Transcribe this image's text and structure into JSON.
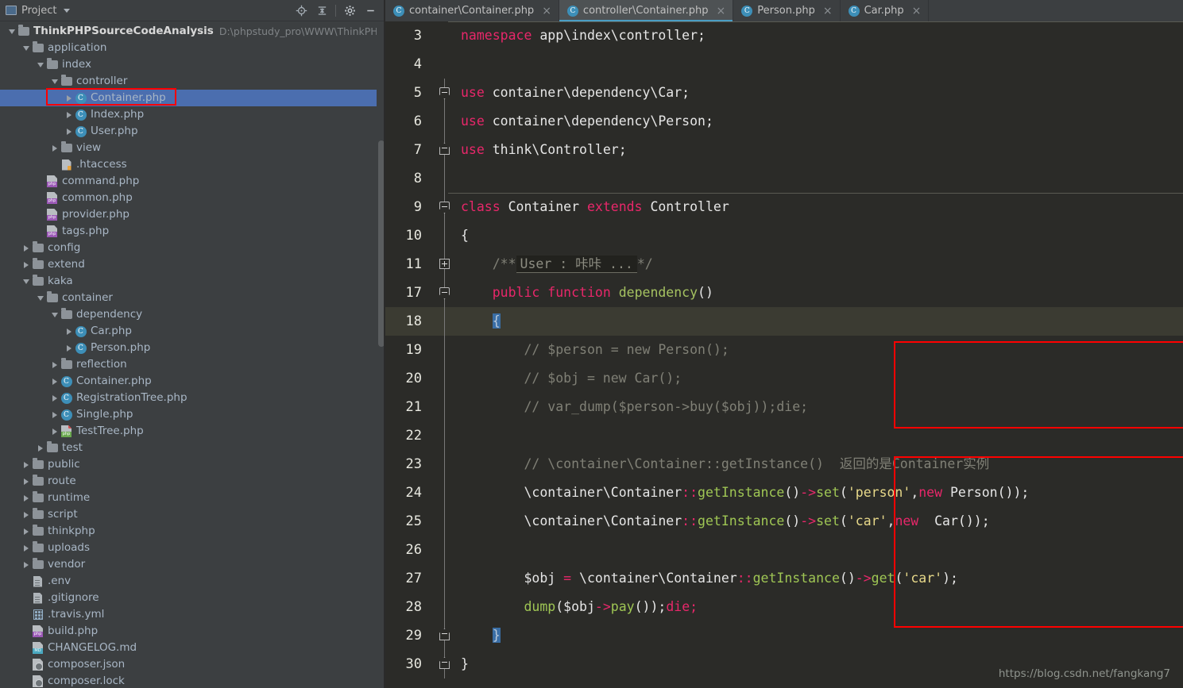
{
  "sidebar": {
    "header": {
      "title": "Project",
      "window_icon": "window-icon",
      "caret": "chevron-down-icon",
      "tools": [
        {
          "name": "locate-target-icon",
          "label": "Select Opened File"
        },
        {
          "name": "collapse-all-icon",
          "label": "Collapse All"
        },
        {
          "name": "gear-icon",
          "label": "Settings"
        },
        {
          "name": "minimize-icon",
          "label": "Hide"
        }
      ]
    },
    "tree": [
      {
        "indent": 0,
        "arrow": "down",
        "icon": "folder",
        "label": "ThinkPHPSourceCodeAnalysis",
        "bold": true,
        "path": "D:\\phpstudy_pro\\WWW\\ThinkPHPSourceCo"
      },
      {
        "indent": 1,
        "arrow": "down",
        "icon": "folder",
        "label": "application"
      },
      {
        "indent": 2,
        "arrow": "down",
        "icon": "folder",
        "label": "index"
      },
      {
        "indent": 3,
        "arrow": "down",
        "icon": "folder",
        "label": "controller"
      },
      {
        "indent": 4,
        "arrow": "right",
        "icon": "class",
        "label": "Container.php",
        "selected": true,
        "highlighted": true
      },
      {
        "indent": 4,
        "arrow": "right",
        "icon": "class",
        "label": "Index.php"
      },
      {
        "indent": 4,
        "arrow": "right",
        "icon": "class",
        "label": "User.php"
      },
      {
        "indent": 3,
        "arrow": "right",
        "icon": "folder",
        "label": "view"
      },
      {
        "indent": 3,
        "arrow": "none",
        "icon": "htaccess",
        "label": ".htaccess"
      },
      {
        "indent": 2,
        "arrow": "none",
        "icon": "php",
        "label": "command.php"
      },
      {
        "indent": 2,
        "arrow": "none",
        "icon": "php",
        "label": "common.php"
      },
      {
        "indent": 2,
        "arrow": "none",
        "icon": "php",
        "label": "provider.php"
      },
      {
        "indent": 2,
        "arrow": "none",
        "icon": "php",
        "label": "tags.php"
      },
      {
        "indent": 1,
        "arrow": "right",
        "icon": "folder",
        "label": "config"
      },
      {
        "indent": 1,
        "arrow": "right",
        "icon": "folder",
        "label": "extend"
      },
      {
        "indent": 1,
        "arrow": "down",
        "icon": "folder",
        "label": "kaka"
      },
      {
        "indent": 2,
        "arrow": "down",
        "icon": "folder",
        "label": "container"
      },
      {
        "indent": 3,
        "arrow": "down",
        "icon": "folder",
        "label": "dependency"
      },
      {
        "indent": 4,
        "arrow": "right",
        "icon": "class",
        "label": "Car.php"
      },
      {
        "indent": 4,
        "arrow": "right",
        "icon": "class",
        "label": "Person.php"
      },
      {
        "indent": 3,
        "arrow": "right",
        "icon": "folder",
        "label": "reflection"
      },
      {
        "indent": 3,
        "arrow": "right",
        "icon": "class",
        "label": "Container.php"
      },
      {
        "indent": 3,
        "arrow": "right",
        "icon": "class",
        "label": "RegistrationTree.php"
      },
      {
        "indent": 3,
        "arrow": "right",
        "icon": "class",
        "label": "Single.php"
      },
      {
        "indent": 3,
        "arrow": "right",
        "icon": "php-green",
        "label": "TestTree.php"
      },
      {
        "indent": 2,
        "arrow": "right",
        "icon": "folder",
        "label": "test"
      },
      {
        "indent": 1,
        "arrow": "right",
        "icon": "folder",
        "label": "public"
      },
      {
        "indent": 1,
        "arrow": "right",
        "icon": "folder",
        "label": "route"
      },
      {
        "indent": 1,
        "arrow": "right",
        "icon": "folder",
        "label": "runtime"
      },
      {
        "indent": 1,
        "arrow": "right",
        "icon": "folder",
        "label": "script"
      },
      {
        "indent": 1,
        "arrow": "right",
        "icon": "folder",
        "label": "thinkphp"
      },
      {
        "indent": 1,
        "arrow": "right",
        "icon": "folder",
        "label": "uploads"
      },
      {
        "indent": 1,
        "arrow": "right",
        "icon": "folder",
        "label": "vendor"
      },
      {
        "indent": 1,
        "arrow": "none",
        "icon": "file",
        "label": ".env"
      },
      {
        "indent": 1,
        "arrow": "none",
        "icon": "file",
        "label": ".gitignore"
      },
      {
        "indent": 1,
        "arrow": "none",
        "icon": "grid",
        "label": ".travis.yml"
      },
      {
        "indent": 1,
        "arrow": "none",
        "icon": "php",
        "label": "build.php"
      },
      {
        "indent": 1,
        "arrow": "none",
        "icon": "md",
        "label": "CHANGELOG.md"
      },
      {
        "indent": 1,
        "arrow": "none",
        "icon": "json",
        "label": "composer.json"
      },
      {
        "indent": 1,
        "arrow": "none",
        "icon": "json",
        "label": "composer.lock"
      }
    ]
  },
  "editor": {
    "tabs": [
      {
        "label": "container\\Container.php",
        "icon": "class-icon",
        "active": false,
        "close": "×"
      },
      {
        "label": "controller\\Container.php",
        "icon": "class-icon",
        "active": true,
        "close": "×"
      },
      {
        "label": "Person.php",
        "icon": "class-icon",
        "active": false,
        "close": "×"
      },
      {
        "label": "Car.php",
        "icon": "class-icon",
        "active": false,
        "close": "×"
      }
    ],
    "lines": [
      {
        "num": "3",
        "fold": "none"
      },
      {
        "num": "4",
        "fold": "none"
      },
      {
        "num": "5",
        "fold": "top"
      },
      {
        "num": "6",
        "fold": "none"
      },
      {
        "num": "7",
        "fold": "bottom"
      },
      {
        "num": "8",
        "fold": "none"
      },
      {
        "num": "9",
        "fold": "top"
      },
      {
        "num": "10",
        "fold": "none"
      },
      {
        "num": "11",
        "fold": "plus"
      },
      {
        "num": "17",
        "fold": "top"
      },
      {
        "num": "18",
        "fold": "none",
        "current": true
      },
      {
        "num": "19",
        "fold": "none"
      },
      {
        "num": "20",
        "fold": "none"
      },
      {
        "num": "21",
        "fold": "none"
      },
      {
        "num": "22",
        "fold": "none"
      },
      {
        "num": "23",
        "fold": "none"
      },
      {
        "num": "24",
        "fold": "none"
      },
      {
        "num": "25",
        "fold": "none"
      },
      {
        "num": "26",
        "fold": "none"
      },
      {
        "num": "27",
        "fold": "none"
      },
      {
        "num": "28",
        "fold": "none"
      },
      {
        "num": "29",
        "fold": "bottom"
      },
      {
        "num": "30",
        "fold": "bottom"
      }
    ],
    "code": {
      "l3": "namespace app\\index\\controller;",
      "l5": "use container\\dependency\\Car;",
      "l6": "use container\\dependency\\Person;",
      "l7": "use think\\Controller;",
      "l9": "class Container extends Controller",
      "l10": "{",
      "l11_pre": "/**",
      "l11_chip": "User : 咔咔 ...",
      "l11_post": "*/",
      "l17": "public function dependency()",
      "l18": "{",
      "l19": "// $person = new Person();",
      "l20": "// $obj = new Car();",
      "l21": "// var_dump($person->buy($obj));die;",
      "l23": "// \\container\\Container::getInstance()  返回的是Container实例",
      "l24": "\\container\\Container::getInstance()->set('person',new Person());",
      "l25": "\\container\\Container::getInstance()->set('car',new  Car());",
      "l27": "$obj = \\container\\Container::getInstance()->get('car');",
      "l28": "dump($obj->pay());die;",
      "l29": "}",
      "l30": "}"
    },
    "annotations": [
      {
        "name": "red-box-commented-block",
        "color": "#ff0000"
      },
      {
        "name": "red-box-container-usage",
        "color": "#ff0000"
      },
      {
        "name": "red-box-tree-selection",
        "color": "#ff0000"
      }
    ]
  },
  "watermark": "https://blog.csdn.net/fangkang7",
  "colors": {
    "sidebar_bg": "#3c3f41",
    "editor_bg": "#2b2b28",
    "selection_blue": "#4b6eaf",
    "accent_tab": "#4a9ec4",
    "annotation_red": "#ff0000",
    "keyword": "#e8276a",
    "comment": "#808076",
    "function": "#a5c261",
    "string": "#e8d98a"
  }
}
